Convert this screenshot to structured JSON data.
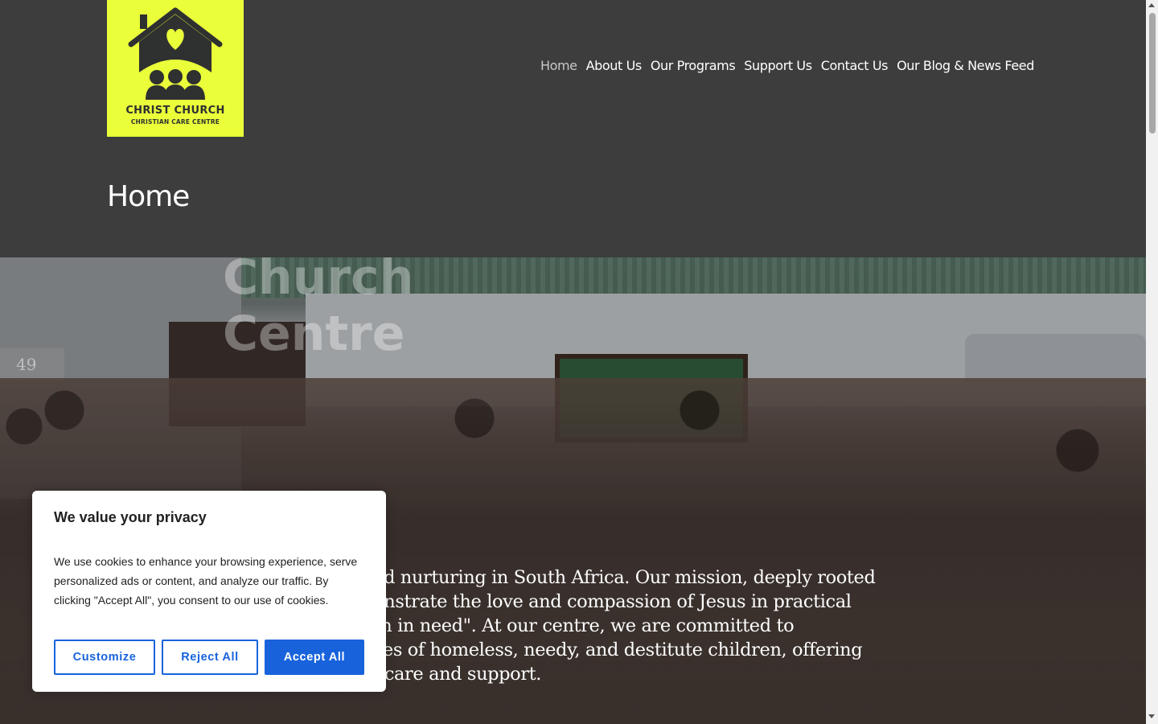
{
  "logo": {
    "title": "CHRIST CHURCH",
    "subtitle": "CHRISTIAN CARE CENTRE",
    "background_color": "#eaff3a",
    "icon": "house-heart-family-icon"
  },
  "nav": {
    "items": [
      {
        "label": "Home",
        "active": true
      },
      {
        "label": "About Us",
        "active": false
      },
      {
        "label": "Our Programs",
        "active": false
      },
      {
        "label": "Support Us",
        "active": false
      },
      {
        "label": "Contact Us",
        "active": false
      },
      {
        "label": "Our Blog & News Feed",
        "active": false
      }
    ]
  },
  "page": {
    "title": "Home"
  },
  "hero": {
    "faded_heading": "Church\nCentre",
    "house_number": "49",
    "text": "and nurturing in South Africa. Our mission, deeply rooted\nnonstrate the love and compassion of Jesus in practical\nren in need\". At our centre, we are committed to\nlives of homeless, needy, and destitute children, offering\nof care and support."
  },
  "cookie_banner": {
    "title": "We value your privacy",
    "text": "We use cookies to enhance your browsing experience, serve personalized ads or content, and analyze our traffic. By clicking \"Accept All\", you consent to our use of cookies.",
    "customize_label": "Customize",
    "reject_label": "Reject All",
    "accept_label": "Accept All",
    "accent_color": "#1863dc"
  },
  "colors": {
    "header_bg": "#3c3d3c",
    "nav_text": "#ffffff"
  }
}
